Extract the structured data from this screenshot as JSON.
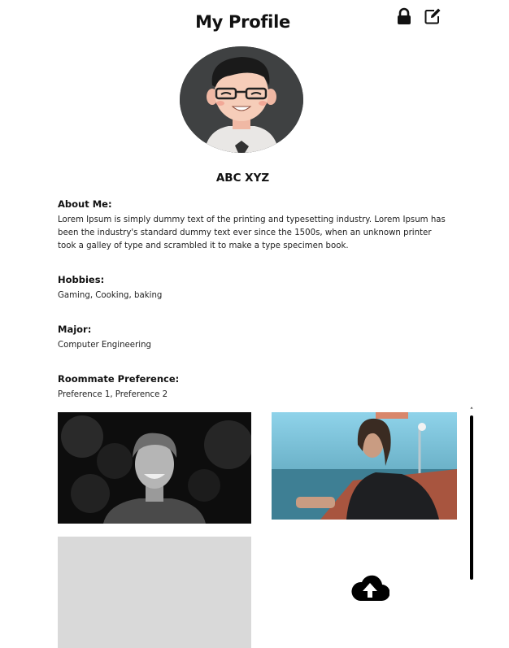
{
  "header": {
    "title": "My Profile",
    "lock_icon": "lock-icon",
    "edit_icon": "edit-icon"
  },
  "profile": {
    "name": "ABC XYZ",
    "avatar_icon": "user-avatar"
  },
  "sections": {
    "about": {
      "label": "About Me:",
      "text": "Lorem Ipsum is simply dummy text of the printing and typesetting industry. Lorem Ipsum has been the industry's standard dummy text ever since the 1500s, when an unknown printer took a galley of type and scrambled it to make a type specimen book."
    },
    "hobbies": {
      "label": "Hobbies:",
      "text": "Gaming, Cooking, baking"
    },
    "major": {
      "label": "Major:",
      "text": "Computer Engineering"
    },
    "preference": {
      "label": "Roommate Preference:",
      "text": "Preference 1, Preference 2"
    }
  },
  "gallery": {
    "upload_icon": "cloud-upload-icon"
  },
  "colors": {
    "background": "#ffffff",
    "text": "#111111",
    "avatar_bg": "#3f4142",
    "placeholder": "#d9d9d9"
  }
}
